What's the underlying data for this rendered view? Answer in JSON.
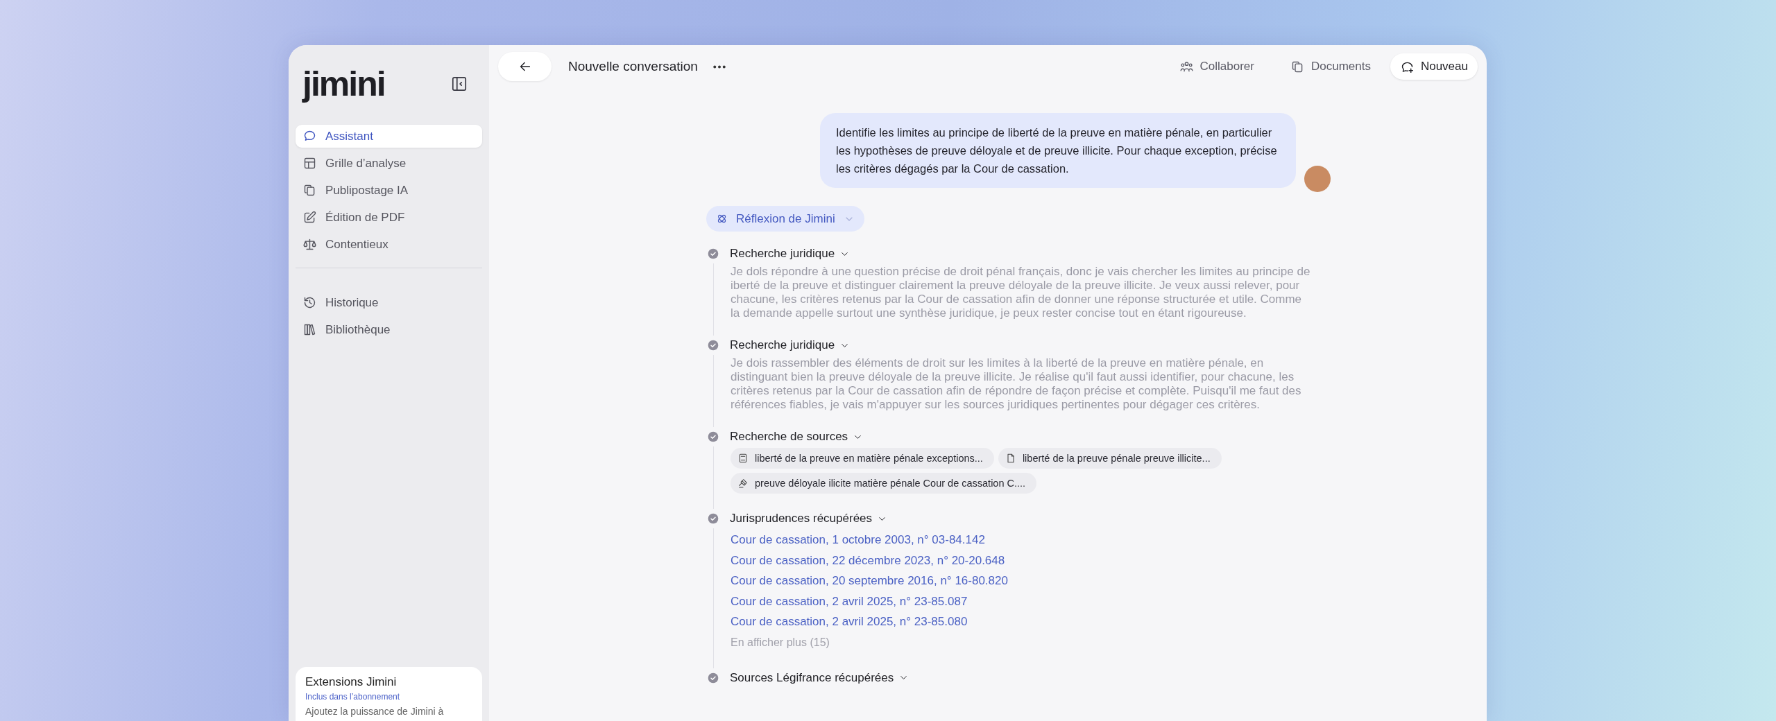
{
  "sidebar": {
    "logo": "jimini",
    "nav": [
      {
        "label": "Assistant",
        "selected": true
      },
      {
        "label": "Grille d’analyse",
        "selected": false
      },
      {
        "label": "Publipostage IA",
        "selected": false
      },
      {
        "label": "Édition de PDF",
        "selected": false
      },
      {
        "label": "Contentieux",
        "selected": false
      }
    ],
    "secondary": [
      {
        "label": "Historique",
        "selected": false
      },
      {
        "label": "Bibliothèque",
        "selected": false
      }
    ],
    "extension": {
      "title": "Extensions Jimini",
      "subtitle": "Inclus dans l’abonnement",
      "description": "Ajoutez la puissance de Jimini à"
    }
  },
  "header": {
    "title": "Nouvelle conversation",
    "actions": [
      {
        "label": "Collaborer",
        "kind": "plain"
      },
      {
        "label": "Documents",
        "kind": "plain"
      },
      {
        "label": "Nouveau",
        "kind": "primary"
      }
    ]
  },
  "conversation": {
    "user_message": "Identifie les limites au principe de liberté de la preuve en matière pénale, en particulier les hypothèses de preuve déloyale et de preuve illicite. Pour chaque exception, précise les critères dégagés par la Cour de cassation.",
    "reasoning_label": "Réflexion de Jimini",
    "steps": [
      {
        "title": "Recherche juridique",
        "done": true,
        "kind": "text",
        "body": "Je dols répondre à une question précise de droit pénal français, donc je vais chercher les limites au principe de iberté de la preuve et distinguer clairement la preuve déloyale de la preuve illicite. Je veux aussi relever, pour chacune, les critères retenus par la Cour de cassation afin de donner une réponse structurée et utile. Comme la demande appelle surtout une synthèse juridique, je peux rester concise tout en étant rigoureuse."
      },
      {
        "title": "Recherche juridique",
        "done": true,
        "kind": "text",
        "body": "Je dois rassembler des éléments de droit sur les limites à la liberté de la preuve en matière pénale, en distinguant bien la preuve déloyale de la preuve illicite. Je réalise qu'il faut aussi identifier, pour chacune, les critères retenus par la Cour de cassation afin de répondre de façon précise et complète. Puisqu'il me faut des références fiables, je vais m'appuyer sur les sources juridiques pertinentes pour dégager ces critères."
      },
      {
        "title": "Recherche de sources",
        "done": true,
        "kind": "chips",
        "chips": [
          "liberté de la preuve en matière pénale exceptions...",
          "liberté de la preuve pénale preuve illicite...",
          "preuve déloyale ilicite matière pénale Cour de cassation C...."
        ]
      },
      {
        "title": "Jurisprudences récupérées",
        "done": true,
        "kind": "links",
        "links": [
          "Cour de cassation, 1 octobre 2003, n° 03-84.142",
          "Cour de cassation, 22 décembre 2023, n° 20-20.648",
          "Cour de cassation, 20 septembre 2016, n° 16-80.820",
          "Cour de cassation, 2 avril 2025, n° 23-85.087",
          "Cour de cassation, 2 avril 2025, n° 23-85.080"
        ],
        "more": "En afficher plus (15)"
      },
      {
        "title": "Sources Légifrance récupérées",
        "done": true,
        "kind": "heading"
      }
    ]
  }
}
